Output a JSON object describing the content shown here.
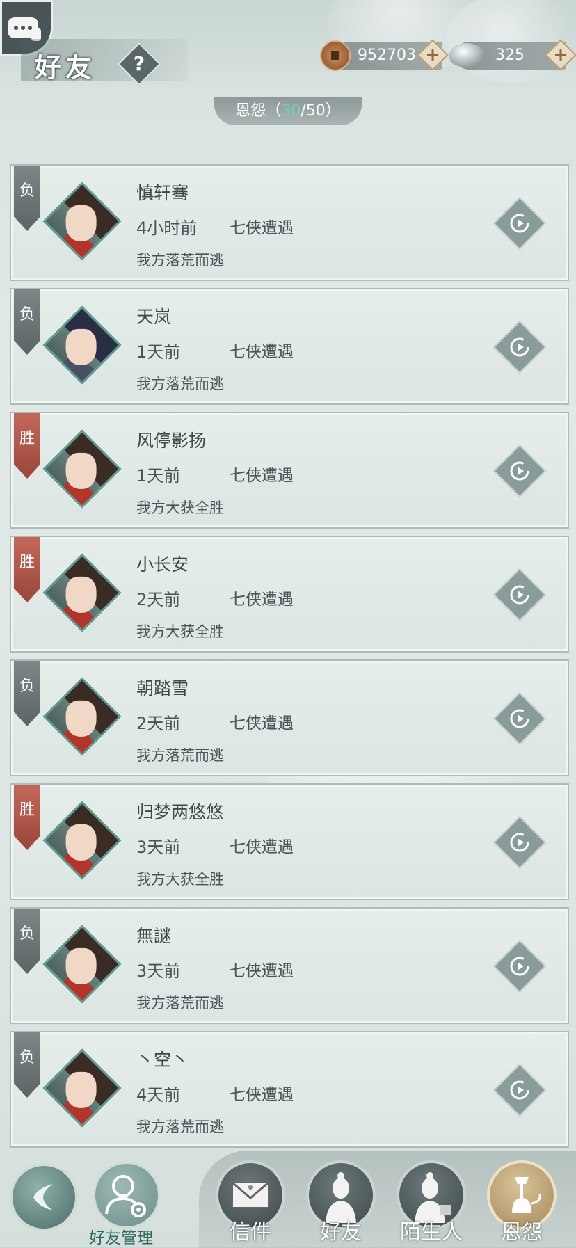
{
  "header": {
    "title": "好友",
    "help_label": "?",
    "copper": "952703",
    "silver": "325",
    "plus": "+"
  },
  "tab": {
    "name": "恩怨",
    "open": "（",
    "current": "30",
    "sep": "/",
    "max": "50",
    "close": "）"
  },
  "records": [
    {
      "result": "负",
      "name": "慎轩骞",
      "time": "4小时前",
      "mode": "七侠遭遇",
      "outcome": "我方落荒而逃"
    },
    {
      "result": "负",
      "name": "天岚",
      "time": "1天前",
      "mode": "七侠遭遇",
      "outcome": "我方落荒而逃"
    },
    {
      "result": "胜",
      "name": "风停影扬",
      "time": "1天前",
      "mode": "七侠遭遇",
      "outcome": "我方大获全胜"
    },
    {
      "result": "胜",
      "name": "小长安",
      "time": "2天前",
      "mode": "七侠遭遇",
      "outcome": "我方大获全胜"
    },
    {
      "result": "负",
      "name": "朝踏雪",
      "time": "2天前",
      "mode": "七侠遭遇",
      "outcome": "我方落荒而逃"
    },
    {
      "result": "胜",
      "name": "归梦两悠悠",
      "time": "3天前",
      "mode": "七侠遭遇",
      "outcome": "我方大获全胜"
    },
    {
      "result": "负",
      "name": "無謎",
      "time": "3天前",
      "mode": "七侠遭遇",
      "outcome": "我方落荒而逃"
    },
    {
      "result": "负",
      "name": "丶空丶",
      "time": "4天前",
      "mode": "七侠遭遇",
      "outcome": "我方落荒而逃"
    }
  ],
  "bottom": {
    "manage_label": "好友管理",
    "nav": [
      "信件",
      "好友",
      "陌生人",
      "恩怨"
    ]
  }
}
